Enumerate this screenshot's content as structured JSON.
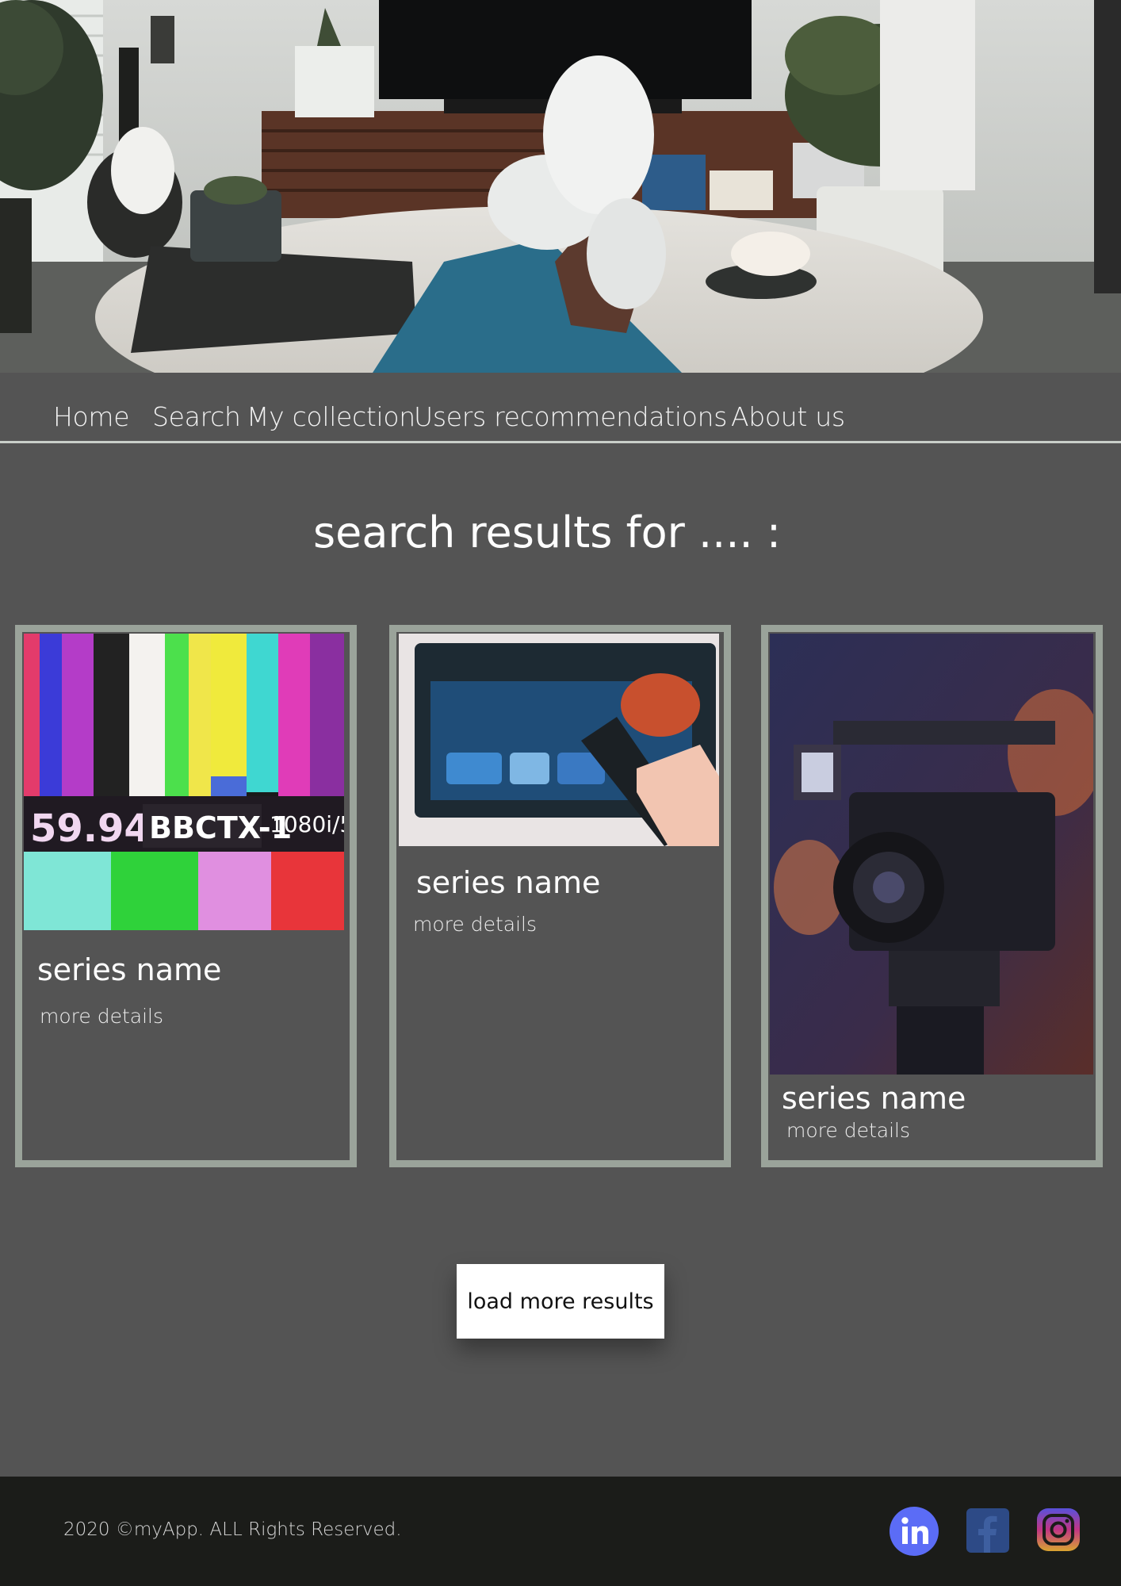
{
  "nav": {
    "items": [
      {
        "label": "Home"
      },
      {
        "label": "Search"
      },
      {
        "label": "My collection"
      },
      {
        "label": "Users recommendations"
      },
      {
        "label": "About us"
      }
    ]
  },
  "main": {
    "title": "search results for .... :",
    "results": [
      {
        "title": "series name",
        "link": "more details",
        "image": "tv-test-pattern-image"
      },
      {
        "title": "series name",
        "link": "more details",
        "image": "tv-remote-image"
      },
      {
        "title": "series name",
        "link": "more details",
        "image": "video-camera-image"
      }
    ],
    "load_more_label": "load more results"
  },
  "footer": {
    "copyright": "2020 ©myApp. ALL Rights Reserved.",
    "social": [
      {
        "icon": "linkedin-icon",
        "color": "#5b6cf6"
      },
      {
        "icon": "facebook-icon",
        "color": "#2d4a86"
      },
      {
        "icon": "instagram-icon",
        "color": "#c13584"
      }
    ]
  },
  "colors": {
    "background": "#545454",
    "card_border": "#9aa39a",
    "footer_background": "#1b1c19",
    "nav_rule": "#c9cfc9"
  }
}
